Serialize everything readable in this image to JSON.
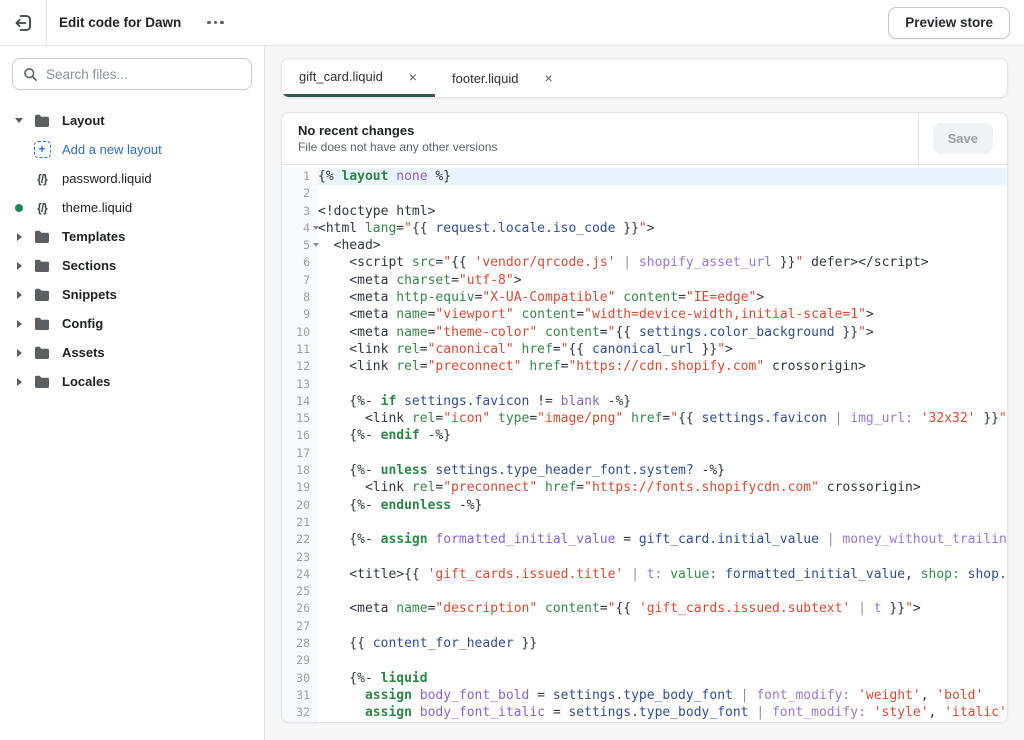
{
  "topbar": {
    "title": "Edit code for Dawn",
    "preview_button": "Preview store"
  },
  "sidebar": {
    "search_placeholder": "Search files...",
    "tree": [
      {
        "id": "layout",
        "kind": "folder",
        "caret": "down",
        "icon": "folder",
        "label": "Layout"
      },
      {
        "id": "add-a-new-layout",
        "kind": "link",
        "caret": "none",
        "icon": "add",
        "label": "Add a new layout"
      },
      {
        "id": "password-liquid",
        "kind": "file",
        "caret": "none",
        "icon": "code",
        "label": "password.liquid"
      },
      {
        "id": "theme-liquid",
        "kind": "file",
        "caret": "dot",
        "icon": "code",
        "label": "theme.liquid"
      },
      {
        "id": "templates",
        "kind": "folder",
        "caret": "right",
        "icon": "folder",
        "label": "Templates"
      },
      {
        "id": "sections",
        "kind": "folder",
        "caret": "right",
        "icon": "folder",
        "label": "Sections"
      },
      {
        "id": "snippets",
        "kind": "folder",
        "caret": "right",
        "icon": "folder",
        "label": "Snippets"
      },
      {
        "id": "config",
        "kind": "folder",
        "caret": "right",
        "icon": "folder",
        "label": "Config"
      },
      {
        "id": "assets",
        "kind": "folder",
        "caret": "right",
        "icon": "folder",
        "label": "Assets"
      },
      {
        "id": "locales",
        "kind": "folder",
        "caret": "right",
        "icon": "folder",
        "label": "Locales"
      }
    ]
  },
  "main": {
    "tabs": [
      {
        "label": "gift_card.liquid",
        "active": true
      },
      {
        "label": "footer.liquid",
        "active": false
      }
    ],
    "close_glyph": "×"
  },
  "editor": {
    "version": {
      "title": "No recent changes",
      "subtitle": "File does not have any other versions",
      "save_label": "Save"
    },
    "code": {
      "active_line": 1,
      "fold_lines": [
        4,
        5
      ],
      "lines": [
        [
          [
            "p",
            "{% "
          ],
          [
            "k",
            "layout"
          ],
          [
            "p",
            " "
          ],
          [
            "d",
            "none"
          ],
          [
            "p",
            " %}"
          ]
        ],
        [],
        [
          [
            "p",
            "<!doctype html>"
          ]
        ],
        [
          [
            "p",
            "<html "
          ],
          [
            "a",
            "lang"
          ],
          [
            "p",
            "="
          ],
          [
            "s",
            "\""
          ],
          [
            "p",
            "{{ "
          ],
          [
            "v",
            "request.locale.iso_code"
          ],
          [
            "p",
            " }}"
          ],
          [
            "s",
            "\""
          ],
          [
            "p",
            ">"
          ]
        ],
        [
          [
            "p",
            "  <head>"
          ]
        ],
        [
          [
            "p",
            "    <script "
          ],
          [
            "a",
            "src"
          ],
          [
            "p",
            "="
          ],
          [
            "s",
            "\""
          ],
          [
            "p",
            "{{ "
          ],
          [
            "s",
            "'vendor/qrcode.js'"
          ],
          [
            "i",
            " | "
          ],
          [
            "f",
            "shopify_asset_url"
          ],
          [
            "p",
            " }}"
          ],
          [
            "s",
            "\""
          ],
          [
            "p",
            " defer></script>"
          ]
        ],
        [
          [
            "p",
            "    <meta "
          ],
          [
            "a",
            "charset"
          ],
          [
            "p",
            "="
          ],
          [
            "s",
            "\"utf-8\""
          ],
          [
            "p",
            ">"
          ]
        ],
        [
          [
            "p",
            "    <meta "
          ],
          [
            "a",
            "http-equiv"
          ],
          [
            "p",
            "="
          ],
          [
            "s",
            "\"X-UA-Compatible\""
          ],
          [
            "p",
            " "
          ],
          [
            "a",
            "content"
          ],
          [
            "p",
            "="
          ],
          [
            "s",
            "\"IE=edge\""
          ],
          [
            "p",
            ">"
          ]
        ],
        [
          [
            "p",
            "    <meta "
          ],
          [
            "a",
            "name"
          ],
          [
            "p",
            "="
          ],
          [
            "s",
            "\"viewport\""
          ],
          [
            "p",
            " "
          ],
          [
            "a",
            "content"
          ],
          [
            "p",
            "="
          ],
          [
            "s",
            "\"width=device-width,initial-scale=1\""
          ],
          [
            "p",
            ">"
          ]
        ],
        [
          [
            "p",
            "    <meta "
          ],
          [
            "a",
            "name"
          ],
          [
            "p",
            "="
          ],
          [
            "s",
            "\"theme-color\""
          ],
          [
            "p",
            " "
          ],
          [
            "a",
            "content"
          ],
          [
            "p",
            "="
          ],
          [
            "s",
            "\""
          ],
          [
            "p",
            "{{ "
          ],
          [
            "v",
            "settings.color_background"
          ],
          [
            "p",
            " }}"
          ],
          [
            "s",
            "\""
          ],
          [
            "p",
            ">"
          ]
        ],
        [
          [
            "p",
            "    <link "
          ],
          [
            "a",
            "rel"
          ],
          [
            "p",
            "="
          ],
          [
            "s",
            "\"canonical\""
          ],
          [
            "p",
            " "
          ],
          [
            "a",
            "href"
          ],
          [
            "p",
            "="
          ],
          [
            "s",
            "\""
          ],
          [
            "p",
            "{{ "
          ],
          [
            "v",
            "canonical_url"
          ],
          [
            "p",
            " }}"
          ],
          [
            "s",
            "\""
          ],
          [
            "p",
            ">"
          ]
        ],
        [
          [
            "p",
            "    <link "
          ],
          [
            "a",
            "rel"
          ],
          [
            "p",
            "="
          ],
          [
            "s",
            "\"preconnect\""
          ],
          [
            "p",
            " "
          ],
          [
            "a",
            "href"
          ],
          [
            "p",
            "="
          ],
          [
            "s",
            "\"https://cdn.shopify.com\""
          ],
          [
            "p",
            " crossorigin>"
          ]
        ],
        [],
        [
          [
            "p",
            "    {%- "
          ],
          [
            "k",
            "if"
          ],
          [
            "p",
            " "
          ],
          [
            "v",
            "settings.favicon"
          ],
          [
            "p",
            " != "
          ],
          [
            "d",
            "blank"
          ],
          [
            "p",
            " -%}"
          ]
        ],
        [
          [
            "p",
            "      <link "
          ],
          [
            "a",
            "rel"
          ],
          [
            "p",
            "="
          ],
          [
            "s",
            "\"icon\""
          ],
          [
            "p",
            " "
          ],
          [
            "a",
            "type"
          ],
          [
            "p",
            "="
          ],
          [
            "s",
            "\"image/png\""
          ],
          [
            "p",
            " "
          ],
          [
            "a",
            "href"
          ],
          [
            "p",
            "="
          ],
          [
            "s",
            "\""
          ],
          [
            "p",
            "{{ "
          ],
          [
            "v",
            "settings.favicon"
          ],
          [
            "i",
            " | "
          ],
          [
            "f",
            "img_url:"
          ],
          [
            "p",
            " "
          ],
          [
            "s",
            "'32x32'"
          ],
          [
            "p",
            " }}"
          ],
          [
            "s",
            "\""
          ],
          [
            "p",
            ">"
          ]
        ],
        [
          [
            "p",
            "    {%- "
          ],
          [
            "k",
            "endif"
          ],
          [
            "p",
            " -%}"
          ]
        ],
        [],
        [
          [
            "p",
            "    {%- "
          ],
          [
            "k",
            "unless"
          ],
          [
            "p",
            " "
          ],
          [
            "v",
            "settings.type_header_font.system?"
          ],
          [
            "p",
            " -%}"
          ]
        ],
        [
          [
            "p",
            "      <link "
          ],
          [
            "a",
            "rel"
          ],
          [
            "p",
            "="
          ],
          [
            "s",
            "\"preconnect\""
          ],
          [
            "p",
            " "
          ],
          [
            "a",
            "href"
          ],
          [
            "p",
            "="
          ],
          [
            "s",
            "\"https://fonts.shopifycdn.com\""
          ],
          [
            "p",
            " crossorigin>"
          ]
        ],
        [
          [
            "p",
            "    {%- "
          ],
          [
            "k",
            "endunless"
          ],
          [
            "p",
            " -%}"
          ]
        ],
        [],
        [
          [
            "p",
            "    {%- "
          ],
          [
            "k",
            "assign"
          ],
          [
            "p",
            " "
          ],
          [
            "d",
            "formatted_initial_value"
          ],
          [
            "p",
            " = "
          ],
          [
            "v",
            "gift_card.initial_value"
          ],
          [
            "i",
            " | "
          ],
          [
            "f",
            "money_without_trailing_zeros"
          ]
        ],
        [],
        [
          [
            "p",
            "    <title>{{ "
          ],
          [
            "s",
            "'gift_cards.issued.title'"
          ],
          [
            "i",
            " | "
          ],
          [
            "f",
            "t:"
          ],
          [
            "p",
            " "
          ],
          [
            "a",
            "value:"
          ],
          [
            "p",
            " "
          ],
          [
            "v",
            "formatted_initial_value"
          ],
          [
            "p",
            ", "
          ],
          [
            "a",
            "shop:"
          ],
          [
            "p",
            " "
          ],
          [
            "v",
            "shop.name"
          ]
        ],
        [],
        [
          [
            "p",
            "    <meta "
          ],
          [
            "a",
            "name"
          ],
          [
            "p",
            "="
          ],
          [
            "s",
            "\"description\""
          ],
          [
            "p",
            " "
          ],
          [
            "a",
            "content"
          ],
          [
            "p",
            "="
          ],
          [
            "s",
            "\""
          ],
          [
            "p",
            "{{ "
          ],
          [
            "s",
            "'gift_cards.issued.subtext'"
          ],
          [
            "i",
            " | "
          ],
          [
            "f",
            "t"
          ],
          [
            "p",
            " }}"
          ],
          [
            "s",
            "\""
          ],
          [
            "p",
            ">"
          ]
        ],
        [],
        [
          [
            "p",
            "    {{ "
          ],
          [
            "v",
            "content_for_header"
          ],
          [
            "p",
            " }}"
          ]
        ],
        [],
        [
          [
            "p",
            "    {%- "
          ],
          [
            "k",
            "liquid"
          ]
        ],
        [
          [
            "p",
            "      "
          ],
          [
            "k",
            "assign"
          ],
          [
            "p",
            " "
          ],
          [
            "d",
            "body_font_bold"
          ],
          [
            "p",
            " = "
          ],
          [
            "v",
            "settings.type_body_font"
          ],
          [
            "i",
            " | "
          ],
          [
            "f",
            "font_modify:"
          ],
          [
            "p",
            " "
          ],
          [
            "s",
            "'weight'"
          ],
          [
            "p",
            ", "
          ],
          [
            "s",
            "'bold'"
          ]
        ],
        [
          [
            "p",
            "      "
          ],
          [
            "k",
            "assign"
          ],
          [
            "p",
            " "
          ],
          [
            "d",
            "body_font_italic"
          ],
          [
            "p",
            " = "
          ],
          [
            "v",
            "settings.type_body_font"
          ],
          [
            "i",
            " | "
          ],
          [
            "f",
            "font_modify:"
          ],
          [
            "p",
            " "
          ],
          [
            "s",
            "'style'"
          ],
          [
            "p",
            ", "
          ],
          [
            "s",
            "'italic'"
          ]
        ]
      ]
    }
  },
  "colors": {
    "active_tab_underline": "#32594e",
    "link_blue": "#2c6ecb",
    "modified_dot_green": "#1a8a54",
    "active_line_bg": "#e9f3fb"
  }
}
